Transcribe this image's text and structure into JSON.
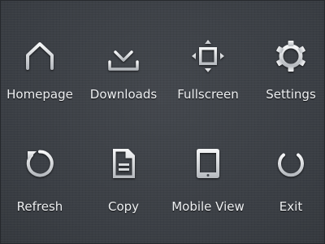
{
  "menu": {
    "items": [
      {
        "id": "homepage",
        "label": "Homepage",
        "icon": "home-icon"
      },
      {
        "id": "downloads",
        "label": "Downloads",
        "icon": "download-icon"
      },
      {
        "id": "fullscreen",
        "label": "Fullscreen",
        "icon": "fullscreen-icon"
      },
      {
        "id": "settings",
        "label": "Settings",
        "icon": "gear-icon"
      },
      {
        "id": "refresh",
        "label": "Refresh",
        "icon": "refresh-icon"
      },
      {
        "id": "copy",
        "label": "Copy",
        "icon": "document-icon"
      },
      {
        "id": "mobile-view",
        "label": "Mobile View",
        "icon": "tablet-icon"
      },
      {
        "id": "exit",
        "label": "Exit",
        "icon": "power-icon"
      }
    ]
  },
  "colors": {
    "background": "#3d4147",
    "icon_light": "#f4f5f6",
    "icon_dark": "#b9bdc2",
    "label": "#eef0f2"
  }
}
